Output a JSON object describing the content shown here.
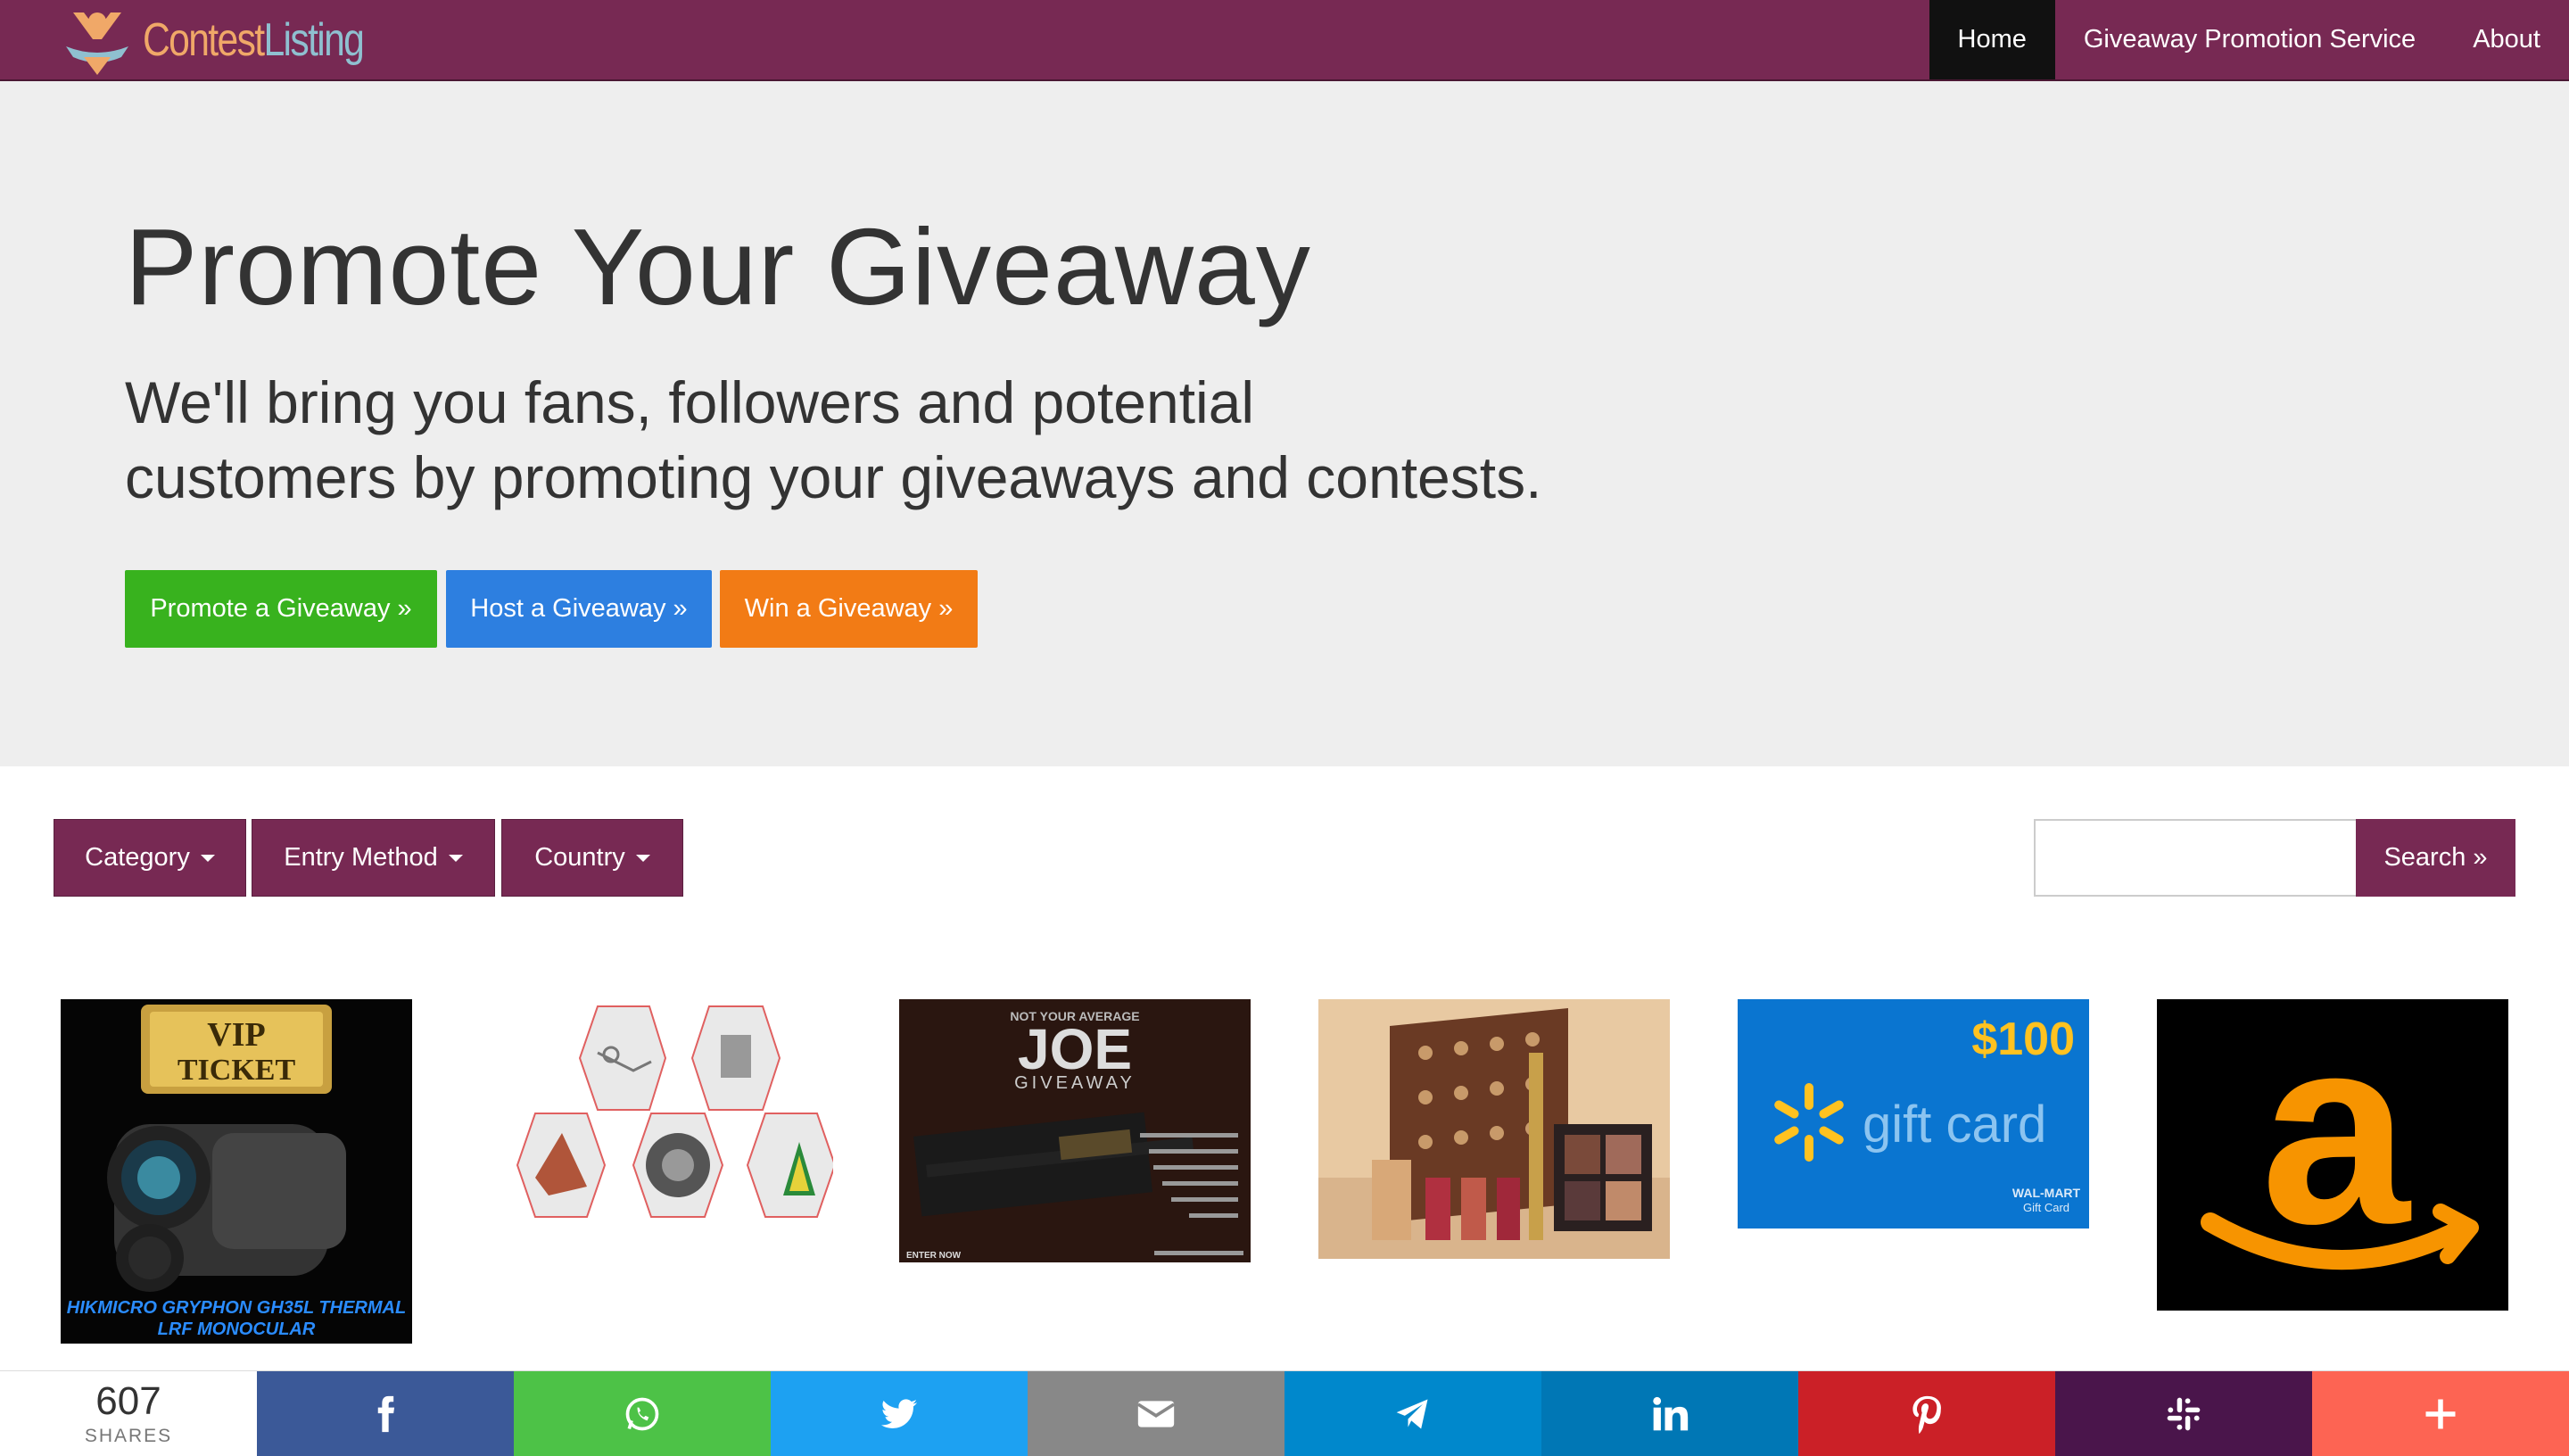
{
  "brand": {
    "name_part1": "Contest",
    "name_part2": "Listing"
  },
  "nav": {
    "items": [
      {
        "label": "Home",
        "active": true
      },
      {
        "label": "Giveaway Promotion Service",
        "active": false
      },
      {
        "label": "About",
        "active": false
      }
    ]
  },
  "hero": {
    "title": "Promote Your Giveaway",
    "subtitle_line1": "We'll bring you fans, followers and potential",
    "subtitle_line2": "customers by promoting your giveaways and contests.",
    "buttons": {
      "promote": "Promote a Giveaway »",
      "host": "Host a Giveaway »",
      "win": "Win a Giveaway »"
    }
  },
  "filters": {
    "category": "Category",
    "entry_method": "Entry Method",
    "country": "Country"
  },
  "search": {
    "placeholder": "",
    "button": "Search »"
  },
  "listings": [
    {
      "image": "vip-ticket-thermal-monocular",
      "badge": "VIP TICKET",
      "caption": "HIKMICRO GRYPHON GH35L THERMAL LRF MONOCULAR"
    },
    {
      "image": "hexagon-puzzles"
    },
    {
      "image": "joe-rifle-giveaway",
      "tagline": "NOT YOUR AVERAGE",
      "headline": "JOE",
      "sub": "GIVEAWAY",
      "cta": "ENTER NOW"
    },
    {
      "image": "cosmetics-gift-set"
    },
    {
      "image": "walmart-gift-card",
      "amount": "$100",
      "label": "gift card",
      "brand_line1": "WAL-MART",
      "brand_line2": "Gift Card"
    },
    {
      "image": "amazon-logo"
    }
  ],
  "share": {
    "count": "607",
    "count_label": "SHARES",
    "buttons": [
      {
        "name": "facebook",
        "color": "#3b5998"
      },
      {
        "name": "whatsapp",
        "color": "#4dc247"
      },
      {
        "name": "twitter",
        "color": "#1da1f2"
      },
      {
        "name": "email",
        "color": "#888888"
      },
      {
        "name": "telegram",
        "color": "#0088cc"
      },
      {
        "name": "linkedin",
        "color": "#0077b5"
      },
      {
        "name": "pinterest",
        "color": "#cb2027"
      },
      {
        "name": "slack",
        "color": "#4a154b"
      },
      {
        "name": "more",
        "color": "#fd6453"
      }
    ]
  },
  "colors": {
    "brand": "#772953",
    "green": "#38b21e",
    "blue": "#2d7fe0",
    "orange": "#f27b15"
  }
}
